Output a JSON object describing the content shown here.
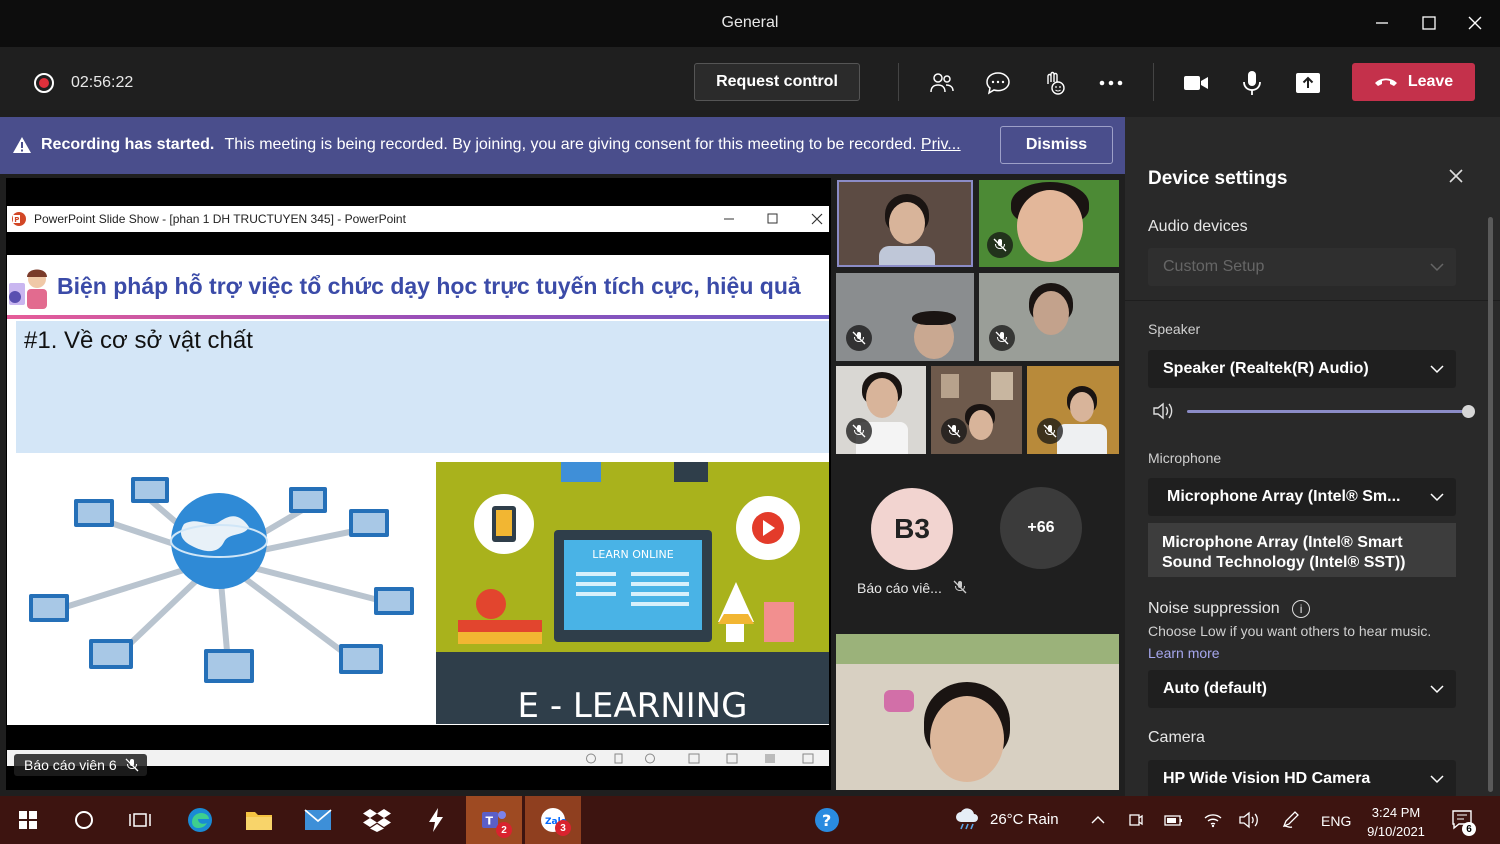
{
  "window": {
    "title": "General"
  },
  "controls": {
    "timer": "02:56:22",
    "request_control": "Request control",
    "leave": "Leave"
  },
  "banner": {
    "title": "Recording has started.",
    "message": "This meeting is being recorded. By joining, you are giving consent for this meeting to be recorded.",
    "privacy_link": "Priv...",
    "dismiss": "Dismiss"
  },
  "presentation": {
    "window_title": "PowerPoint Slide Show - [phan 1 DH TRUCTUYEN 345] - PowerPoint",
    "slide_title": "Biện pháp hỗ trợ việc tổ chức dạy học trực tuyến tích cực, hiệu quả",
    "slide_subtitle": "#1. Về cơ sở vật chất",
    "screen_label": "LEARN ONLINE",
    "banner_text": "E - LEARNING",
    "presenter": "Báo cáo viên 6"
  },
  "participants": {
    "b3_initials": "B3",
    "b3_name": "Báo cáo viê...",
    "overflow": "+66"
  },
  "device_settings": {
    "title": "Device settings",
    "audio_devices_label": "Audio devices",
    "audio_devices_value": "Custom Setup",
    "speaker_label": "Speaker",
    "speaker_value": "Speaker (Realtek(R) Audio)",
    "speaker_volume": 1.0,
    "microphone_label": "Microphone",
    "microphone_value": "Microphone Array (Intel® Sm...",
    "microphone_option": "Microphone Array (Intel® Smart Sound Technology (Intel® SST))",
    "noise_label": "Noise suppression",
    "noise_help": "Choose Low if you want others to hear music.",
    "learn_more": "Learn more",
    "noise_value": "Auto (default)",
    "camera_label": "Camera",
    "camera_value": "HP Wide Vision HD Camera"
  },
  "taskbar": {
    "teams_badge": "2",
    "zalo_badge": "3",
    "weather": "26°C  Rain",
    "language": "ENG",
    "time": "3:24 PM",
    "date": "9/10/2021",
    "notifications": "6"
  },
  "colors": {
    "leave": "#c4314b",
    "banner": "#4a4e8c",
    "accent": "#8b8cc7",
    "taskbar": "#3d1410"
  }
}
